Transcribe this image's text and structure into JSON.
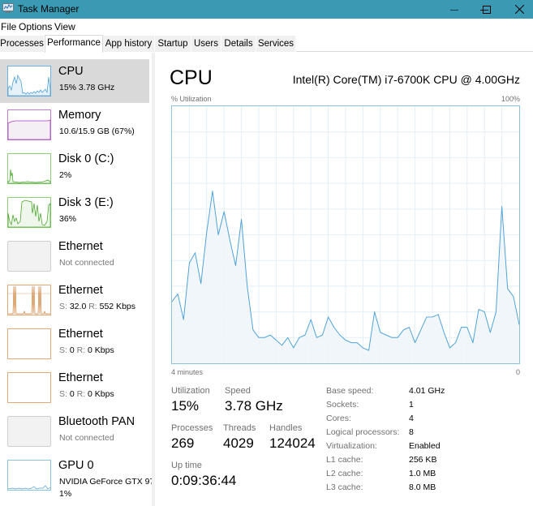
{
  "window": {
    "title": "Task Manager",
    "controls": [
      "minimize",
      "maximize",
      "close"
    ]
  },
  "menu": [
    "File",
    "Options",
    "View"
  ],
  "tabs": [
    {
      "label": "Processes",
      "active": false
    },
    {
      "label": "Performance",
      "active": true
    },
    {
      "label": "App history",
      "active": false
    },
    {
      "label": "Startup",
      "active": false
    },
    {
      "label": "Users",
      "active": false
    },
    {
      "label": "Details",
      "active": false
    },
    {
      "label": "Services",
      "active": false
    }
  ],
  "sidebar": {
    "items": [
      {
        "name": "CPU",
        "sub": "15% 3.78 GHz",
        "color": "#1a8ad4",
        "selected": true
      },
      {
        "name": "Memory",
        "sub": "10.6/15.9 GB (67%)",
        "color": "#a83ec0",
        "selected": false
      },
      {
        "name": "Disk 0 (C:)",
        "sub": "2%",
        "color": "#4da82e",
        "selected": false
      },
      {
        "name": "Disk 3 (E:)",
        "sub": "36%",
        "color": "#4da82e",
        "selected": false
      },
      {
        "name": "Ethernet",
        "sub": "Not connected",
        "color": "#bdbdbd",
        "selected": false
      },
      {
        "name": "Ethernet",
        "sub_s_label": "S:",
        "sub_s": "32.0",
        "sub_r_label": "R:",
        "sub_r": "552 Kbps",
        "color": "#d0843e",
        "selected": false
      },
      {
        "name": "Ethernet",
        "sub_s_label": "S:",
        "sub_s": "0",
        "sub_r_label": "R:",
        "sub_r": "0 Kbps",
        "color": "#d0843e",
        "selected": false
      },
      {
        "name": "Ethernet",
        "sub_s_label": "S:",
        "sub_s": "0",
        "sub_r_label": "R:",
        "sub_r": "0 Kbps",
        "color": "#d0843e",
        "selected": false
      },
      {
        "name": "Bluetooth PAN",
        "sub": "Not connected",
        "color": "#bdbdbd",
        "selected": false
      },
      {
        "name": "GPU 0",
        "sub": "NVIDIA GeForce GTX 97",
        "sub2": "1%",
        "color": "#1a8ad4",
        "selected": false
      }
    ]
  },
  "main": {
    "title": "CPU",
    "model": "Intel(R) Core(TM) i7-6700K CPU @ 4.00GHz",
    "y_label": "% Utilization",
    "y_max_label": "100%",
    "x_left_label": "4 minutes",
    "x_right_label": "0",
    "stats": {
      "utilization_label": "Utilization",
      "utilization": "15%",
      "speed_label": "Speed",
      "speed": "3.78 GHz",
      "processes_label": "Processes",
      "processes": "269",
      "threads_label": "Threads",
      "threads": "4029",
      "handles_label": "Handles",
      "handles": "124024",
      "uptime_label": "Up time",
      "uptime": "0:09:36:44"
    },
    "specs": [
      {
        "label": "Base speed:",
        "value": "4.01 GHz"
      },
      {
        "label": "Sockets:",
        "value": "1"
      },
      {
        "label": "Cores:",
        "value": "4"
      },
      {
        "label": "Logical processors:",
        "value": "8"
      },
      {
        "label": "Virtualization:",
        "value": "Enabled"
      },
      {
        "label": "L1 cache:",
        "value": "256 KB"
      },
      {
        "label": "L2 cache:",
        "value": "1.0 MB"
      },
      {
        "label": "L3 cache:",
        "value": "8.0 MB"
      }
    ]
  },
  "chart_data": {
    "type": "area",
    "title": "CPU % Utilization",
    "xlabel": "4 minutes → 0",
    "ylabel": "% Utilization",
    "ylim": [
      0,
      100
    ],
    "xlim_seconds": [
      -240,
      0
    ],
    "grid": true,
    "grid_rows": 10,
    "grid_cols": 20,
    "line_color": "#4fa3d8",
    "fill_color": "#eef5fa",
    "values": [
      24,
      27,
      17,
      39,
      43,
      31,
      51,
      67,
      50,
      59,
      48,
      38,
      56,
      30,
      13,
      10,
      10,
      11,
      9,
      7,
      10,
      6,
      10,
      11,
      17,
      10,
      11,
      18,
      14,
      11,
      9,
      8,
      8,
      6,
      5,
      20,
      12,
      11,
      10,
      10,
      13,
      14,
      8,
      13,
      18,
      18,
      19,
      12,
      6,
      8,
      14,
      14,
      8,
      21,
      20,
      12,
      20,
      61,
      29,
      26,
      15
    ]
  }
}
